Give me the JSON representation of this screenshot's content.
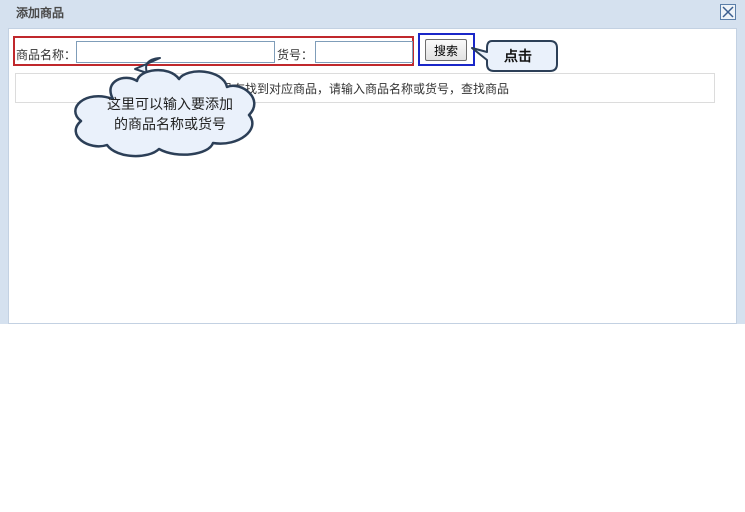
{
  "dialog": {
    "title": "添加商品",
    "close_icon": "close-x-icon"
  },
  "search": {
    "name_label": "商品名称：",
    "name_value": "",
    "code_label": "货号：",
    "code_value": "",
    "button_label": "搜索"
  },
  "results": {
    "message": "没有找到对应商品，请输入商品名称或货号，查找商品"
  },
  "annotations": {
    "cloud_line1": "这里可以输入要添加",
    "cloud_line2": "的商品名称或货号",
    "click_note": "点击"
  },
  "colors": {
    "frame_bg": "#d5e1ef",
    "search_highlight": "#c0282c",
    "button_highlight": "#1a27c8",
    "callout_fill": "#eaf1fb",
    "callout_stroke": "#2c3f57"
  }
}
